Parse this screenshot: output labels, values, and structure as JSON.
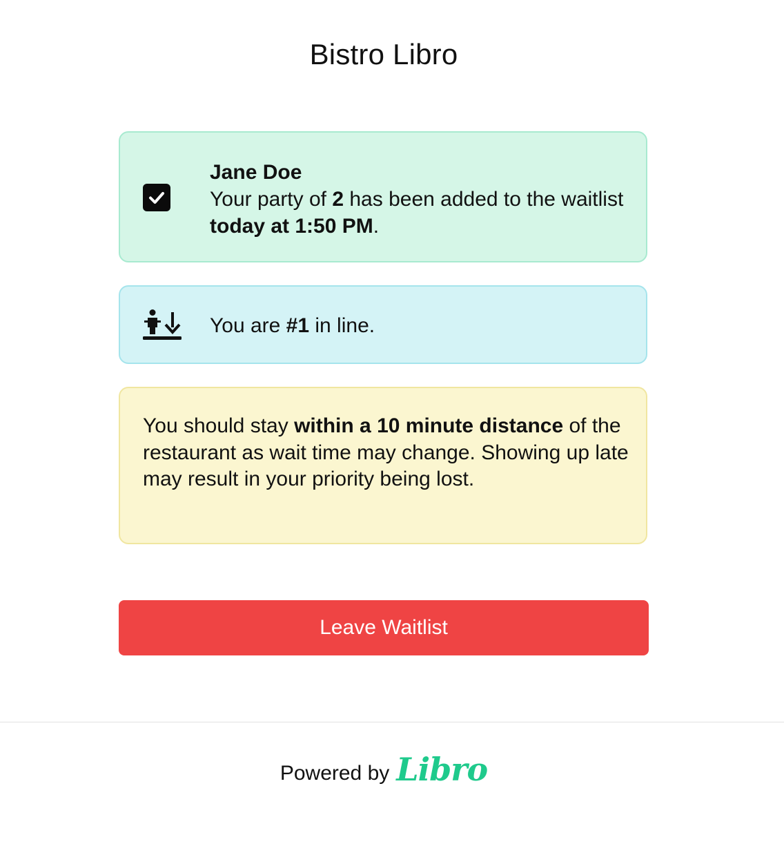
{
  "header": {
    "restaurant_name": "Bistro Libro"
  },
  "confirmation": {
    "icon": "check-square-icon",
    "guest_name": "Jane Doe",
    "text_before_size": "Your party of ",
    "party_size": "2",
    "text_after_size": " has been added to the waitlist ",
    "time_added": "today at 1:50 PM",
    "text_end": "."
  },
  "position": {
    "icon": "person-in-line-icon",
    "text_before": "You are ",
    "place": "#1",
    "text_after": " in line."
  },
  "notice": {
    "text_before": "You should stay ",
    "emphasis": "within a 10 minute distance",
    "text_after": " of the restaurant as wait time may change. Showing up late may result in your priority being lost."
  },
  "actions": {
    "leave_label": "Leave Waitlist"
  },
  "footer": {
    "powered_by": "Powered by",
    "brand": "Libro"
  },
  "colors": {
    "confirm_bg": "#d5f6e7",
    "position_bg": "#d4f3f6",
    "notice_bg": "#fbf6d0",
    "leave_button": "#ef4444",
    "brand": "#1fca8c"
  }
}
